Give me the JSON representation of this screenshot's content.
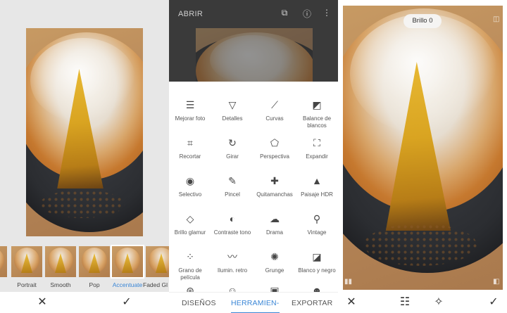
{
  "left_panel": {
    "filters": [
      {
        "label": "",
        "selected": false
      },
      {
        "label": "Portrait",
        "selected": false
      },
      {
        "label": "Smooth",
        "selected": false
      },
      {
        "label": "Pop",
        "selected": false
      },
      {
        "label": "Accentuate",
        "selected": true
      },
      {
        "label": "Faded Gl",
        "selected": false
      }
    ],
    "bottom_bar": {
      "cancel_icon": "close-icon",
      "cancel_glyph": "✕",
      "apply_icon": "check-icon",
      "apply_glyph": "✓"
    }
  },
  "middle_panel": {
    "header": {
      "open_label": "ABRIR",
      "icons": [
        "layers-icon",
        "info-icon",
        "more-vert-icon"
      ]
    },
    "tools": [
      {
        "label": "Mejorar foto",
        "icon": "tune-icon",
        "glyph": "☰"
      },
      {
        "label": "Detalles",
        "icon": "triangle-icon",
        "glyph": "▽"
      },
      {
        "label": "Curvas",
        "icon": "curves-icon",
        "glyph": "⟋"
      },
      {
        "label": "Balance de blancos",
        "icon": "wb-icon",
        "glyph": "◩"
      },
      {
        "label": "Recortar",
        "icon": "crop-icon",
        "glyph": "⌗"
      },
      {
        "label": "Girar",
        "icon": "rotate-icon",
        "glyph": "↻"
      },
      {
        "label": "Perspectiva",
        "icon": "perspective-icon",
        "glyph": "⬠"
      },
      {
        "label": "Expandir",
        "icon": "expand-icon",
        "glyph": "⛶"
      },
      {
        "label": "Selectivo",
        "icon": "target-icon",
        "glyph": "◉"
      },
      {
        "label": "Pincel",
        "icon": "brush-icon",
        "glyph": "✎"
      },
      {
        "label": "Quitamanchas",
        "icon": "bandage-icon",
        "glyph": "✚"
      },
      {
        "label": "Paisaje HDR",
        "icon": "mountain-icon",
        "glyph": "▲"
      },
      {
        "label": "Brillo glamur",
        "icon": "diamond-icon",
        "glyph": "◇"
      },
      {
        "label": "Contraste tono",
        "icon": "contrast-icon",
        "glyph": "◐"
      },
      {
        "label": "Drama",
        "icon": "cloud-icon",
        "glyph": "☁"
      },
      {
        "label": "Vintage",
        "icon": "lamp-icon",
        "glyph": "⚲"
      },
      {
        "label": "Grano de película",
        "icon": "grain-icon",
        "glyph": "⁘"
      },
      {
        "label": "Ilumin. retro",
        "icon": "mustache-icon",
        "glyph": "〰"
      },
      {
        "label": "Grunge",
        "icon": "grunge-icon",
        "glyph": "✺"
      },
      {
        "label": "Blanco y negro",
        "icon": "bw-icon",
        "glyph": "◪"
      },
      {
        "label": "",
        "icon": "face-icon",
        "glyph": "⊛"
      },
      {
        "label": "",
        "icon": "smile-icon",
        "glyph": "☺"
      },
      {
        "label": "",
        "icon": "portrait-icon",
        "glyph": "▣"
      },
      {
        "label": "",
        "icon": "emoji-icon",
        "glyph": "☻"
      }
    ],
    "tabs": [
      {
        "label": "DISEÑOS",
        "active": false
      },
      {
        "label": "HERRAMIEN-",
        "active": true
      },
      {
        "label": "EXPORTAR",
        "active": false
      }
    ]
  },
  "right_panel": {
    "badge": "Brillo 0",
    "bottom_bar": {
      "cancel_glyph": "✕",
      "adjust_glyph": "☷",
      "auto_glyph": "✧",
      "apply_glyph": "✓"
    }
  },
  "colors": {
    "accent": "#3a86d6",
    "dark_header": "#3a3a3a"
  }
}
